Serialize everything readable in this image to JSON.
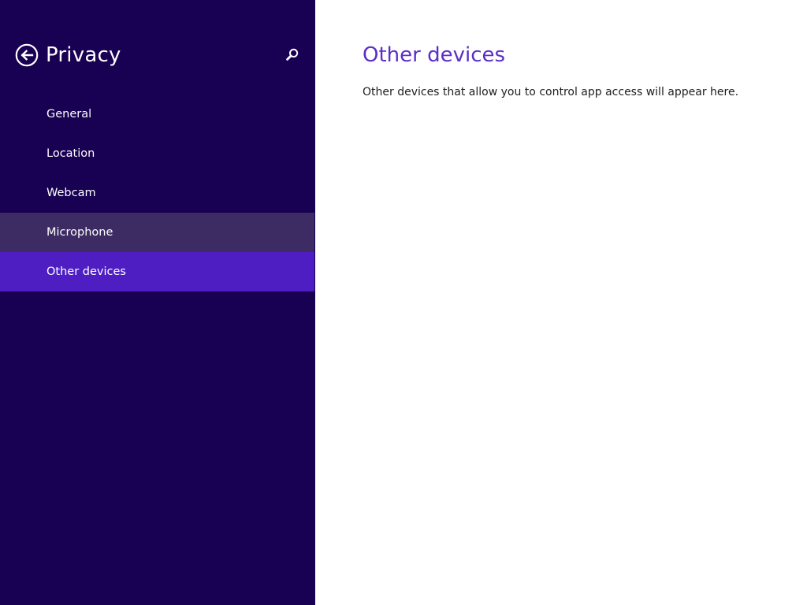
{
  "sidebar": {
    "title": "Privacy",
    "back_icon": "back-arrow-circle-icon",
    "search_icon": "search-icon",
    "background_color": "#180052",
    "items": [
      {
        "label": "General",
        "state": "normal"
      },
      {
        "label": "Location",
        "state": "normal"
      },
      {
        "label": "Webcam",
        "state": "normal"
      },
      {
        "label": "Microphone",
        "state": "hover"
      },
      {
        "label": "Other devices",
        "state": "selected"
      }
    ],
    "hover_color": "#3d2b64",
    "selected_color": "#4e1ec3"
  },
  "main": {
    "title": "Other devices",
    "description": "Other devices that allow you to control app access will appear here.",
    "title_color": "#5b2ec7"
  }
}
